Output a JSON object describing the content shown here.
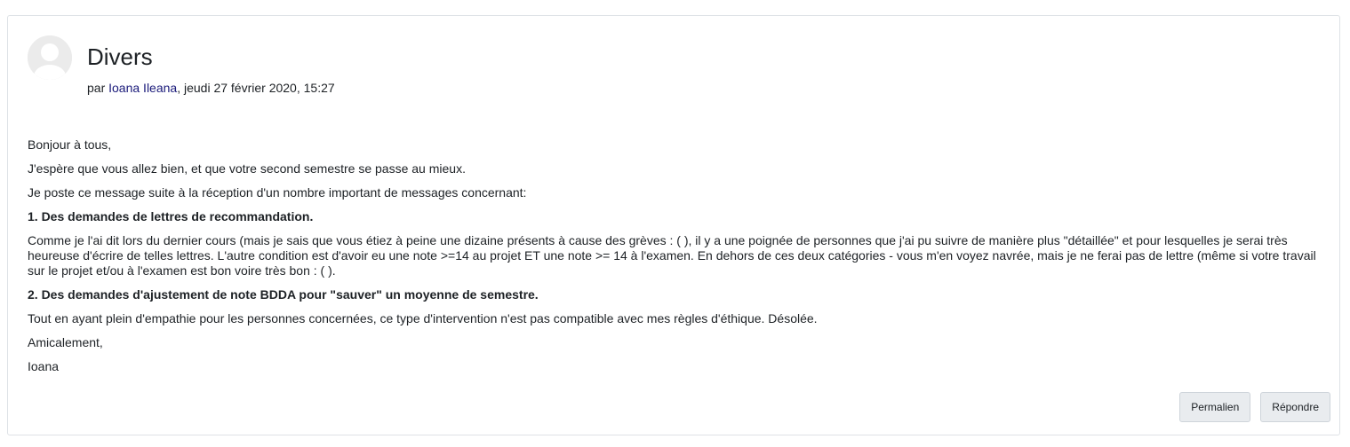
{
  "post": {
    "subject": "Divers",
    "byline_prefix": "par ",
    "author": "Ioana Ileana",
    "byline_suffix": ", jeudi 27 février 2020, 15:27",
    "paragraphs": [
      "Bonjour à tous,",
      "J'espère que vous allez bien, et que votre second semestre se passe au mieux.",
      "Je poste ce message suite à la réception d'un nombre important de messages concernant:",
      "1. Des demandes de lettres de recommandation.",
      "Comme je l'ai dit lors du dernier cours (mais je sais que vous étiez à peine une dizaine présents à cause des grèves : ( ), il y a une poignée de personnes que j'ai pu suivre de manière plus \"détaillée\" et pour lesquelles je serai très heureuse d'écrire de telles lettres. L'autre condition est d'avoir eu une note >=14 au projet ET une note >= 14 à l'examen. En dehors de ces deux catégories - vous m'en voyez navrée, mais je ne ferai pas de lettre (même si votre travail sur le projet et/ou à l'examen est bon voire très bon : ( ).",
      "2. Des demandes d'ajustement de note BDDA pour \"sauver\" un moyenne de semestre.",
      "Tout en ayant plein d'empathie pour les personnes concernées, ce type d'intervention n'est pas compatible avec mes règles d'éthique. Désolée.",
      "Amicalement,",
      "Ioana"
    ]
  },
  "actions": {
    "permalink_label": "Permalien",
    "reply_label": "Répondre"
  },
  "icons": {
    "avatar": "default-user-avatar-icon"
  },
  "colors": {
    "author_link": "#1a1a7a",
    "border": "#dee2e6",
    "button_bg": "#e9ecef"
  }
}
